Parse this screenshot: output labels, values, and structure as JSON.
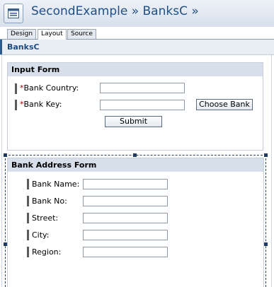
{
  "header": {
    "title": "SecondExample » BanksC »",
    "icon": "form-icon"
  },
  "tabs": [
    {
      "label": "Design"
    },
    {
      "label": "Layout",
      "active": true
    },
    {
      "label": "Source"
    }
  ],
  "page": {
    "title": "BanksC"
  },
  "input_form": {
    "title": "Input Form",
    "required_marker": "*",
    "fields": [
      {
        "label": "Bank Country:",
        "value": "",
        "required": true
      },
      {
        "label": "Bank Key:",
        "value": "",
        "required": true
      }
    ],
    "choose_bank_label": "Choose Bank",
    "submit_label": "Submit"
  },
  "address_form": {
    "title": "Bank Address Form",
    "fields": [
      {
        "label": "Bank Name:",
        "value": ""
      },
      {
        "label": "Bank No:",
        "value": ""
      },
      {
        "label": "Street:",
        "value": ""
      },
      {
        "label": "City:",
        "value": ""
      },
      {
        "label": "Region:",
        "value": ""
      }
    ]
  },
  "colors": {
    "title_text": "#1f4f86",
    "required": "#b50000",
    "panel_header": "#d7e0ea",
    "selection": "#23436d"
  }
}
